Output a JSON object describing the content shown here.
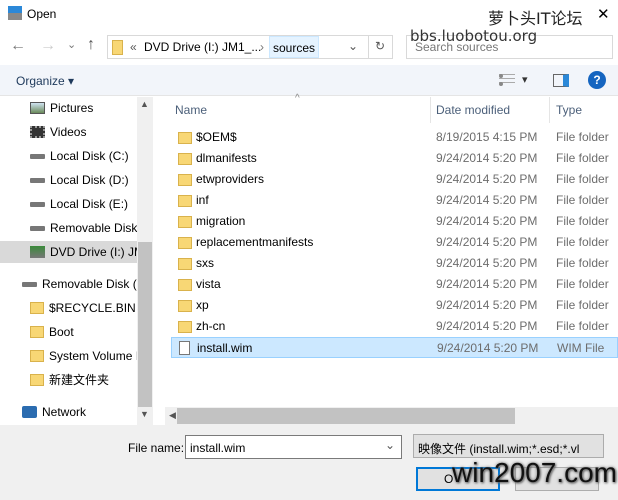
{
  "window": {
    "title": "Open",
    "watermark_top": "萝卜头IT论坛",
    "watermark_url": "bbs.luobotou.org",
    "watermark_bottom": "win2007.com",
    "close": "✕"
  },
  "nav": {
    "back": "←",
    "forward": "→",
    "recent": "⌄",
    "up": "↑",
    "breadcrumb_prefix": "«",
    "breadcrumb": [
      "DVD Drive (I:) JM1_...",
      "sources"
    ],
    "refresh": "↻",
    "search_placeholder": "Search sources"
  },
  "toolbar": {
    "organize": "Organize ▾",
    "view": "▾",
    "help": "?"
  },
  "sidebar": {
    "items": [
      {
        "label": "Pictures",
        "icon": "pictures-icon"
      },
      {
        "label": "Videos",
        "icon": "videos-icon"
      },
      {
        "label": "Local Disk (C:)",
        "icon": "drive-icon"
      },
      {
        "label": "Local Disk (D:)",
        "icon": "drive-icon"
      },
      {
        "label": "Local Disk (E:)",
        "icon": "drive-icon"
      },
      {
        "label": "Removable Disk",
        "icon": "drive-icon"
      },
      {
        "label": "DVD Drive (I:) JM",
        "icon": "dvd-icon",
        "selected": true
      },
      {
        "label": "Removable Disk (F",
        "icon": "drive-icon"
      },
      {
        "label": "$RECYCLE.BIN",
        "icon": "folder-icon"
      },
      {
        "label": "Boot",
        "icon": "folder-icon"
      },
      {
        "label": "System Volume I",
        "icon": "folder-icon"
      },
      {
        "label": "新建文件夹",
        "icon": "folder-icon"
      },
      {
        "label": "Network",
        "icon": "network-icon"
      }
    ]
  },
  "columns": {
    "name": "Name",
    "date": "Date modified",
    "type": "Type"
  },
  "files": [
    {
      "name": "$OEM$",
      "date": "8/19/2015 4:15 PM",
      "type": "File folder"
    },
    {
      "name": "dlmanifests",
      "date": "9/24/2014 5:20 PM",
      "type": "File folder"
    },
    {
      "name": "etwproviders",
      "date": "9/24/2014 5:20 PM",
      "type": "File folder"
    },
    {
      "name": "inf",
      "date": "9/24/2014 5:20 PM",
      "type": "File folder"
    },
    {
      "name": "migration",
      "date": "9/24/2014 5:20 PM",
      "type": "File folder"
    },
    {
      "name": "replacementmanifests",
      "date": "9/24/2014 5:20 PM",
      "type": "File folder"
    },
    {
      "name": "sxs",
      "date": "9/24/2014 5:20 PM",
      "type": "File folder"
    },
    {
      "name": "vista",
      "date": "9/24/2014 5:20 PM",
      "type": "File folder"
    },
    {
      "name": "xp",
      "date": "9/24/2014 5:20 PM",
      "type": "File folder"
    },
    {
      "name": "zh-cn",
      "date": "9/24/2014 5:20 PM",
      "type": "File folder"
    },
    {
      "name": "install.wim",
      "date": "9/24/2014 5:20 PM",
      "type": "WIM File",
      "selected": true
    }
  ],
  "footer": {
    "file_name_label": "File name:",
    "file_name_value": "install.wim",
    "file_type": "映像文件 (install.wim;*.esd;*.vl",
    "open": "O"
  }
}
